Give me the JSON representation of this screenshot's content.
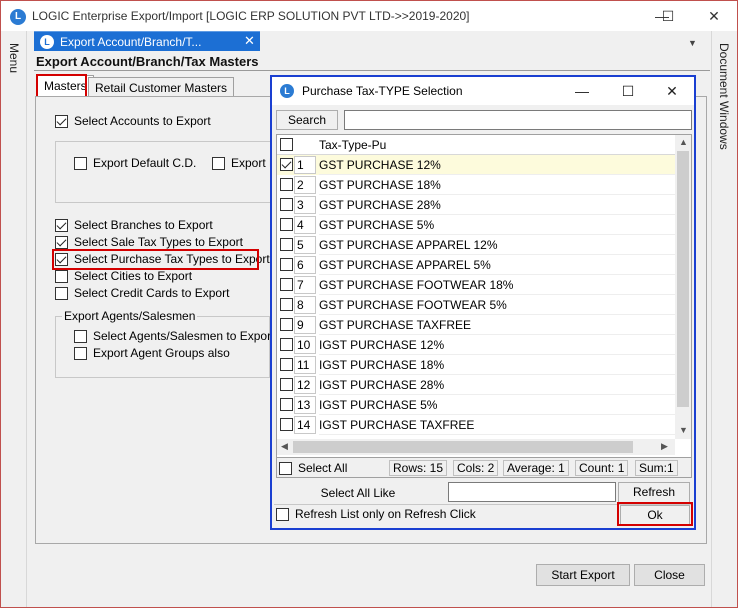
{
  "window": {
    "title": "LOGIC Enterprise Export/Import  [LOGIC ERP SOLUTION PVT LTD->>2019-2020]",
    "minimize": "—",
    "maximize": "☐",
    "close": "✕"
  },
  "side": {
    "menu_label": "Menu",
    "docwin_label": "Document Windows"
  },
  "doc_tab": {
    "label": "Export Account/Branch/T...",
    "close": "✕",
    "chevron": "▼"
  },
  "form": {
    "title": "Export Account/Branch/Tax Masters",
    "tabs": [
      "Masters",
      "Retail Customer Masters"
    ],
    "select_accounts": "Select Accounts to Export",
    "export_default_cd": "Export Default C.D.",
    "export_d": "Export D",
    "select_branches": "Select Branches to Export",
    "select_sale_tax": "Select Sale Tax Types to Export",
    "select_purchase_tax": "Select Purchase Tax Types to Export",
    "select_cities": "Select Cities to Export",
    "select_credit_cards": "Select Credit Cards to Export",
    "agents_group": "Export Agents/Salesmen",
    "select_agents": "Select Agents/Salesmen to Export",
    "export_agent_groups": "Export Agent Groups also",
    "start_export": "Start Export",
    "close_btn": "Close"
  },
  "dialog": {
    "title": "Purchase Tax-TYPE Selection",
    "minimize": "—",
    "maximize": "☐",
    "close": "✕",
    "search_label": "Search",
    "search_value": "",
    "column_header": "Tax-Type-Pu",
    "rows": [
      {
        "num": "1",
        "name": "GST PURCHASE 12%",
        "checked": true
      },
      {
        "num": "2",
        "name": "GST PURCHASE 18%",
        "checked": false
      },
      {
        "num": "3",
        "name": "GST PURCHASE 28%",
        "checked": false
      },
      {
        "num": "4",
        "name": "GST PURCHASE 5%",
        "checked": false
      },
      {
        "num": "5",
        "name": "GST PURCHASE APPAREL 12%",
        "checked": false
      },
      {
        "num": "6",
        "name": "GST PURCHASE APPAREL 5%",
        "checked": false
      },
      {
        "num": "7",
        "name": "GST PURCHASE FOOTWEAR 18%",
        "checked": false
      },
      {
        "num": "8",
        "name": "GST PURCHASE FOOTWEAR 5%",
        "checked": false
      },
      {
        "num": "9",
        "name": "GST PURCHASE TAXFREE",
        "checked": false
      },
      {
        "num": "10",
        "name": "IGST PURCHASE  12%",
        "checked": false
      },
      {
        "num": "11",
        "name": "IGST PURCHASE 18%",
        "checked": false
      },
      {
        "num": "12",
        "name": "IGST PURCHASE 28%",
        "checked": false
      },
      {
        "num": "13",
        "name": "IGST PURCHASE 5%",
        "checked": false
      },
      {
        "num": "14",
        "name": "IGST PURCHASE TAXFREE",
        "checked": false
      }
    ],
    "select_all": "Select All",
    "stats": {
      "rows": "Rows: 15",
      "cols": "Cols: 2",
      "average": "Average: 1",
      "count": "Count: 1",
      "sum": "Sum:1"
    },
    "select_all_like": "Select All Like",
    "select_all_like_value": "",
    "refresh": "Refresh",
    "refresh_only": "Refresh List only on Refresh Click",
    "ok": "Ok"
  },
  "colors": {
    "accent": "#1c6fd4",
    "highlight_red": "#d40000",
    "dialog_border": "#1a3fd1",
    "selected_row": "#fdfbdc"
  }
}
